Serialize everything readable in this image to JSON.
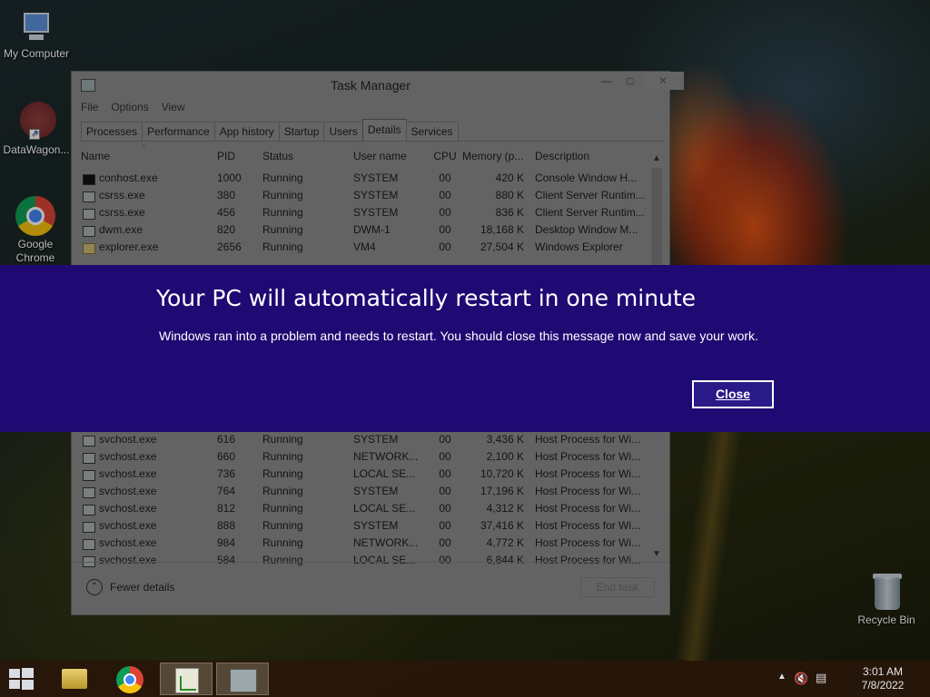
{
  "desktop": {
    "icons": [
      {
        "label": "My Computer"
      },
      {
        "label": "DataWagon..."
      },
      {
        "label": "Google Chrome"
      },
      {
        "label": "Recycle Bin"
      }
    ]
  },
  "task_manager": {
    "title": "Task Manager",
    "menu": [
      "File",
      "Options",
      "View"
    ],
    "tabs": [
      "Processes",
      "Performance",
      "App history",
      "Startup",
      "Users",
      "Details",
      "Services"
    ],
    "active_tab": "Details",
    "columns": [
      "Name",
      "PID",
      "Status",
      "User name",
      "CPU",
      "Memory (p...",
      "Description"
    ],
    "rows_top": [
      {
        "name": "conhost.exe",
        "pid": "1000",
        "status": "Running",
        "user": "SYSTEM",
        "cpu": "00",
        "mem": "420 K",
        "desc": "Console Window H..."
      },
      {
        "name": "csrss.exe",
        "pid": "380",
        "status": "Running",
        "user": "SYSTEM",
        "cpu": "00",
        "mem": "880 K",
        "desc": "Client Server Runtim..."
      },
      {
        "name": "csrss.exe",
        "pid": "456",
        "status": "Running",
        "user": "SYSTEM",
        "cpu": "00",
        "mem": "836 K",
        "desc": "Client Server Runtim..."
      },
      {
        "name": "dwm.exe",
        "pid": "820",
        "status": "Running",
        "user": "DWM-1",
        "cpu": "00",
        "mem": "18,168 K",
        "desc": "Desktop Window M..."
      },
      {
        "name": "explorer.exe",
        "pid": "2656",
        "status": "Running",
        "user": "VM4",
        "cpu": "00",
        "mem": "27,504 K",
        "desc": "Windows Explorer"
      }
    ],
    "rows_bottom": [
      {
        "name": "svchost.exe",
        "pid": "616",
        "status": "Running",
        "user": "SYSTEM",
        "cpu": "00",
        "mem": "3,436 K",
        "desc": "Host Process for Wi..."
      },
      {
        "name": "svchost.exe",
        "pid": "660",
        "status": "Running",
        "user": "NETWORK...",
        "cpu": "00",
        "mem": "2,100 K",
        "desc": "Host Process for Wi..."
      },
      {
        "name": "svchost.exe",
        "pid": "736",
        "status": "Running",
        "user": "LOCAL SE...",
        "cpu": "00",
        "mem": "10,720 K",
        "desc": "Host Process for Wi..."
      },
      {
        "name": "svchost.exe",
        "pid": "764",
        "status": "Running",
        "user": "SYSTEM",
        "cpu": "00",
        "mem": "17,196 K",
        "desc": "Host Process for Wi..."
      },
      {
        "name": "svchost.exe",
        "pid": "812",
        "status": "Running",
        "user": "LOCAL SE...",
        "cpu": "00",
        "mem": "4,312 K",
        "desc": "Host Process for Wi..."
      },
      {
        "name": "svchost.exe",
        "pid": "888",
        "status": "Running",
        "user": "SYSTEM",
        "cpu": "00",
        "mem": "37,416 K",
        "desc": "Host Process for Wi..."
      },
      {
        "name": "svchost.exe",
        "pid": "984",
        "status": "Running",
        "user": "NETWORK...",
        "cpu": "00",
        "mem": "4,772 K",
        "desc": "Host Process for Wi..."
      },
      {
        "name": "svchost.exe",
        "pid": "584",
        "status": "Running",
        "user": "LOCAL SE...",
        "cpu": "00",
        "mem": "6,844 K",
        "desc": "Host Process for Wi..."
      }
    ],
    "footer": {
      "fewer_details": "Fewer details",
      "end_task": "End task"
    }
  },
  "restart_dialog": {
    "title": "Your PC will automatically restart in one minute",
    "message": "Windows ran into a problem and needs to restart. You should close this message now and save your work.",
    "close_label": "Close",
    "background_color": "#1e0a72"
  },
  "taskbar": {
    "clock_time": "3:01 AM",
    "clock_date": "7/8/2022",
    "icons": [
      "windows-start-icon",
      "file-explorer-icon",
      "chrome-icon",
      "chart-app-icon",
      "task-manager-icon"
    ]
  }
}
